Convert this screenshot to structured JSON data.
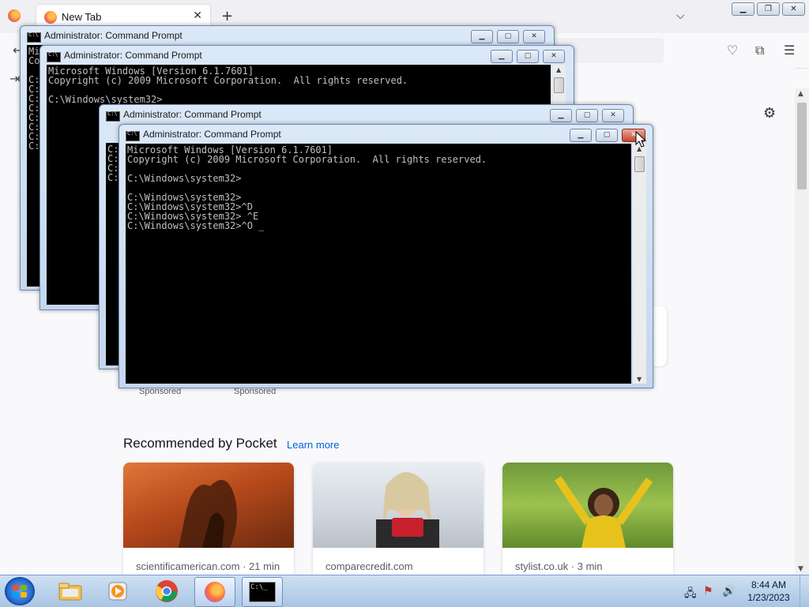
{
  "browser": {
    "tab_title": "New Tab",
    "new_tab_glyph": "+",
    "list_tabs_glyph": "⌵",
    "sponsored": [
      "Sponsored",
      "Sponsored"
    ],
    "pocket": {
      "heading": "Recommended by Pocket",
      "learn_more": "Learn more",
      "cards": [
        {
          "source": "scientificamerican.com · 21 min"
        },
        {
          "source": "comparecredit.com"
        },
        {
          "source": "stylist.co.uk · 3 min"
        }
      ]
    }
  },
  "cmd_windows": [
    {
      "title": "Administrator: Command Prompt",
      "text": "Mi\nCo\n\nC:\nC:\nC:\nC:\nC:\nC:\nC:\nC:"
    },
    {
      "title": "Administrator: Command Prompt",
      "text": "Microsoft Windows [Version 6.1.7601]\nCopyright (c) 2009 Microsoft Corporation.  All rights reserved.\n\nC:\\Windows\\system32>"
    },
    {
      "title": "Administrator: Command Prompt",
      "text": "C:\nC:\nC:\nC:"
    },
    {
      "title": "Administrator: Command Prompt",
      "text": "Microsoft Windows [Version 6.1.7601]\nCopyright (c) 2009 Microsoft Corporation.  All rights reserved.\n\nC:\\Windows\\system32>\n\nC:\\Windows\\system32>\nC:\\Windows\\system32>^D\nC:\\Windows\\system32> ^E\nC:\\Windows\\system32>^O _"
    }
  ],
  "taskbar": {
    "time": "8:44 AM",
    "date": "1/23/2023",
    "apps": [
      "windows-explorer",
      "media-player",
      "chrome",
      "firefox",
      "command-prompt"
    ]
  },
  "colors": {
    "console_bg": "#000000",
    "console_fg": "#c0c0c0",
    "link": "#0061e0",
    "close_button": "#c7442c"
  }
}
